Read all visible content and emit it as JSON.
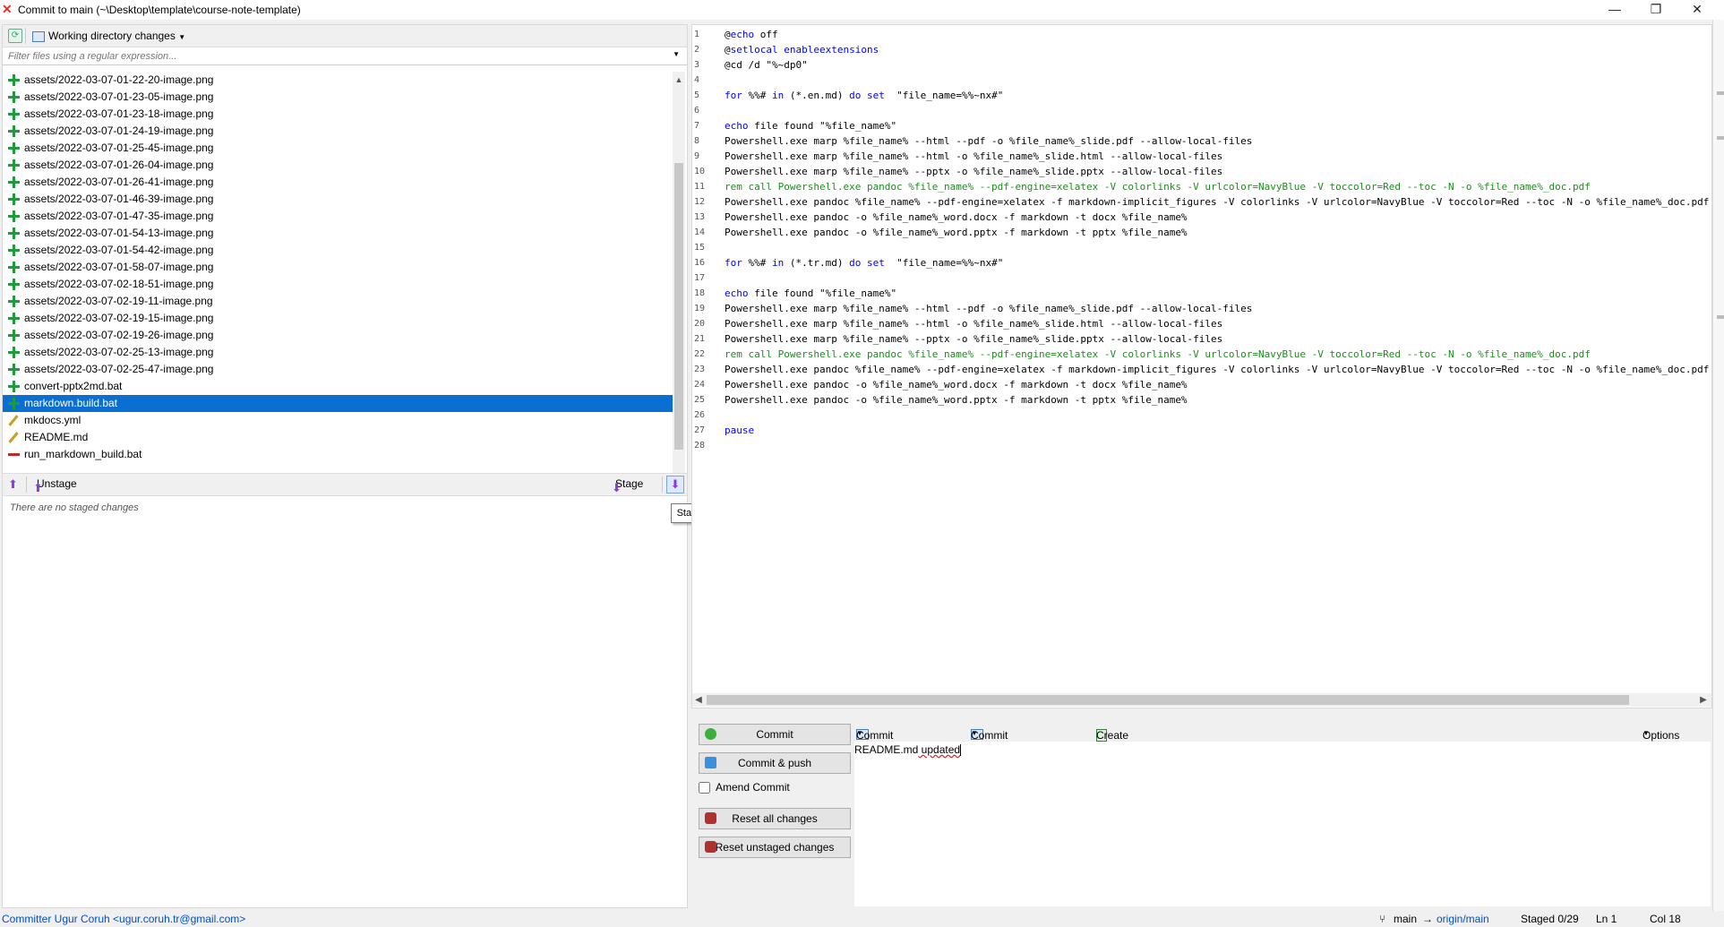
{
  "window": {
    "title": "Commit to main (~\\Desktop\\template\\course-note-template)",
    "minimize": "—",
    "restore": "❐",
    "close": "✕"
  },
  "left": {
    "view_selector": "Working directory changes",
    "filter_placeholder": "Filter files using a regular expression...",
    "files": [
      {
        "name": "assets/2022-03-07-01-22-20-image.png",
        "status": "added"
      },
      {
        "name": "assets/2022-03-07-01-23-05-image.png",
        "status": "added"
      },
      {
        "name": "assets/2022-03-07-01-23-18-image.png",
        "status": "added"
      },
      {
        "name": "assets/2022-03-07-01-24-19-image.png",
        "status": "added"
      },
      {
        "name": "assets/2022-03-07-01-25-45-image.png",
        "status": "added"
      },
      {
        "name": "assets/2022-03-07-01-26-04-image.png",
        "status": "added"
      },
      {
        "name": "assets/2022-03-07-01-26-41-image.png",
        "status": "added"
      },
      {
        "name": "assets/2022-03-07-01-46-39-image.png",
        "status": "added"
      },
      {
        "name": "assets/2022-03-07-01-47-35-image.png",
        "status": "added"
      },
      {
        "name": "assets/2022-03-07-01-54-13-image.png",
        "status": "added"
      },
      {
        "name": "assets/2022-03-07-01-54-42-image.png",
        "status": "added"
      },
      {
        "name": "assets/2022-03-07-01-58-07-image.png",
        "status": "added"
      },
      {
        "name": "assets/2022-03-07-02-18-51-image.png",
        "status": "added"
      },
      {
        "name": "assets/2022-03-07-02-19-11-image.png",
        "status": "added"
      },
      {
        "name": "assets/2022-03-07-02-19-15-image.png",
        "status": "added"
      },
      {
        "name": "assets/2022-03-07-02-19-26-image.png",
        "status": "added"
      },
      {
        "name": "assets/2022-03-07-02-25-13-image.png",
        "status": "added"
      },
      {
        "name": "assets/2022-03-07-02-25-47-image.png",
        "status": "added"
      },
      {
        "name": "convert-pptx2md.bat",
        "status": "added"
      },
      {
        "name": "markdown.build.bat",
        "status": "added",
        "selected": true
      },
      {
        "name": "mkdocs.yml",
        "status": "modified"
      },
      {
        "name": "README.md",
        "status": "modified"
      },
      {
        "name": "run_markdown_build.bat",
        "status": "deleted"
      }
    ],
    "unstage_label": "Unstage",
    "stage_label": "Stage",
    "stage_all_tooltip": "Stage all",
    "no_staged": "There are no staged changes"
  },
  "editor": {
    "lines": [
      [
        {
          "t": "@",
          "c": ""
        },
        {
          "t": "echo",
          "c": "kw"
        },
        {
          "t": " off",
          "c": ""
        }
      ],
      [
        {
          "t": "@",
          "c": ""
        },
        {
          "t": "setlocal enableextensions",
          "c": "kw"
        }
      ],
      [
        {
          "t": "@cd /d \"%~dp0\"",
          "c": ""
        }
      ],
      [],
      [
        {
          "t": "for",
          "c": "kw"
        },
        {
          "t": " %%# ",
          "c": ""
        },
        {
          "t": "in",
          "c": "kw"
        },
        {
          "t": " (*.en.md) ",
          "c": ""
        },
        {
          "t": "do",
          "c": "kw"
        },
        {
          "t": " ",
          "c": ""
        },
        {
          "t": "set",
          "c": "kw"
        },
        {
          "t": "  \"file_name=%%~nx#\"",
          "c": ""
        }
      ],
      [],
      [
        {
          "t": "echo",
          "c": "kw"
        },
        {
          "t": " file found \"%file_name%\"",
          "c": ""
        }
      ],
      [
        {
          "t": "Powershell.exe marp %file_name% --html --pdf -o %file_name%_slide.pdf --allow-local-files",
          "c": ""
        }
      ],
      [
        {
          "t": "Powershell.exe marp %file_name% --html -o %file_name%_slide.html --allow-local-files",
          "c": ""
        }
      ],
      [
        {
          "t": "Powershell.exe marp %file_name% --pptx -o %file_name%_slide.pptx --allow-local-files",
          "c": ""
        }
      ],
      [
        {
          "t": "rem call Powershell.exe pandoc %file_name% --pdf-engine=xelatex -V colorlinks -V urlcolor=NavyBlue -V toccolor=Red --toc -N -o %file_name%_doc.pdf",
          "c": "cm"
        }
      ],
      [
        {
          "t": "Powershell.exe pandoc %file_name% --pdf-engine=xelatex -f markdown-implicit_figures -V colorlinks -V urlcolor=NavyBlue -V toccolor=Red --toc -N -o %file_name%_doc.pdf",
          "c": ""
        }
      ],
      [
        {
          "t": "Powershell.exe pandoc -o %file_name%_word.docx -f markdown -t docx %file_name%",
          "c": ""
        }
      ],
      [
        {
          "t": "Powershell.exe pandoc -o %file_name%_word.pptx -f markdown -t pptx %file_name%",
          "c": ""
        }
      ],
      [],
      [
        {
          "t": "for",
          "c": "kw"
        },
        {
          "t": " %%# ",
          "c": ""
        },
        {
          "t": "in",
          "c": "kw"
        },
        {
          "t": " (*.tr.md) ",
          "c": ""
        },
        {
          "t": "do",
          "c": "kw"
        },
        {
          "t": " ",
          "c": ""
        },
        {
          "t": "set",
          "c": "kw"
        },
        {
          "t": "  \"file_name=%%~nx#\"",
          "c": ""
        }
      ],
      [],
      [
        {
          "t": "echo",
          "c": "kw"
        },
        {
          "t": " file found \"%file_name%\"",
          "c": ""
        }
      ],
      [
        {
          "t": "Powershell.exe marp %file_name% --html --pdf -o %file_name%_slide.pdf --allow-local-files",
          "c": ""
        }
      ],
      [
        {
          "t": "Powershell.exe marp %file_name% --html -o %file_name%_slide.html --allow-local-files",
          "c": ""
        }
      ],
      [
        {
          "t": "Powershell.exe marp %file_name% --pptx -o %file_name%_slide.pptx --allow-local-files",
          "c": ""
        }
      ],
      [
        {
          "t": "rem call Powershell.exe pandoc %file_name% --pdf-engine=xelatex -V colorlinks -V urlcolor=NavyBlue -V toccolor=Red --toc -N -o %file_name%_doc.pdf",
          "c": "cm"
        }
      ],
      [
        {
          "t": "Powershell.exe pandoc %file_name% --pdf-engine=xelatex -f markdown-implicit_figures -V colorlinks -V urlcolor=NavyBlue -V toccolor=Red --toc -N -o %file_name%_doc.pdf",
          "c": ""
        }
      ],
      [
        {
          "t": "Powershell.exe pandoc -o %file_name%_word.docx -f markdown -t docx %file_name%",
          "c": ""
        }
      ],
      [
        {
          "t": "Powershell.exe pandoc -o %file_name%_word.pptx -f markdown -t pptx %file_name%",
          "c": ""
        }
      ],
      [],
      [
        {
          "t": "pause",
          "c": "kw"
        }
      ],
      []
    ]
  },
  "commit": {
    "commit_label": "Commit",
    "commit_push_label": "Commit & push",
    "amend_label": "Amend Commit",
    "reset_all_label": "Reset all changes",
    "reset_unstaged_label": "Reset unstaged changes",
    "commit_message_menu": "Commit message",
    "commit_templates_menu": "Commit templates",
    "create_branch_label": "Create branch",
    "options_label": "Options",
    "message_word1": "README.md",
    "message_word2": " updated"
  },
  "status": {
    "committer": "Committer Ugur Coruh <ugur.coruh.tr@gmail.com>",
    "branch": "main",
    "arrow": "→",
    "remote": "origin/main",
    "staged": "Staged  0/29",
    "line": "Ln  1",
    "col": "Col  18"
  }
}
